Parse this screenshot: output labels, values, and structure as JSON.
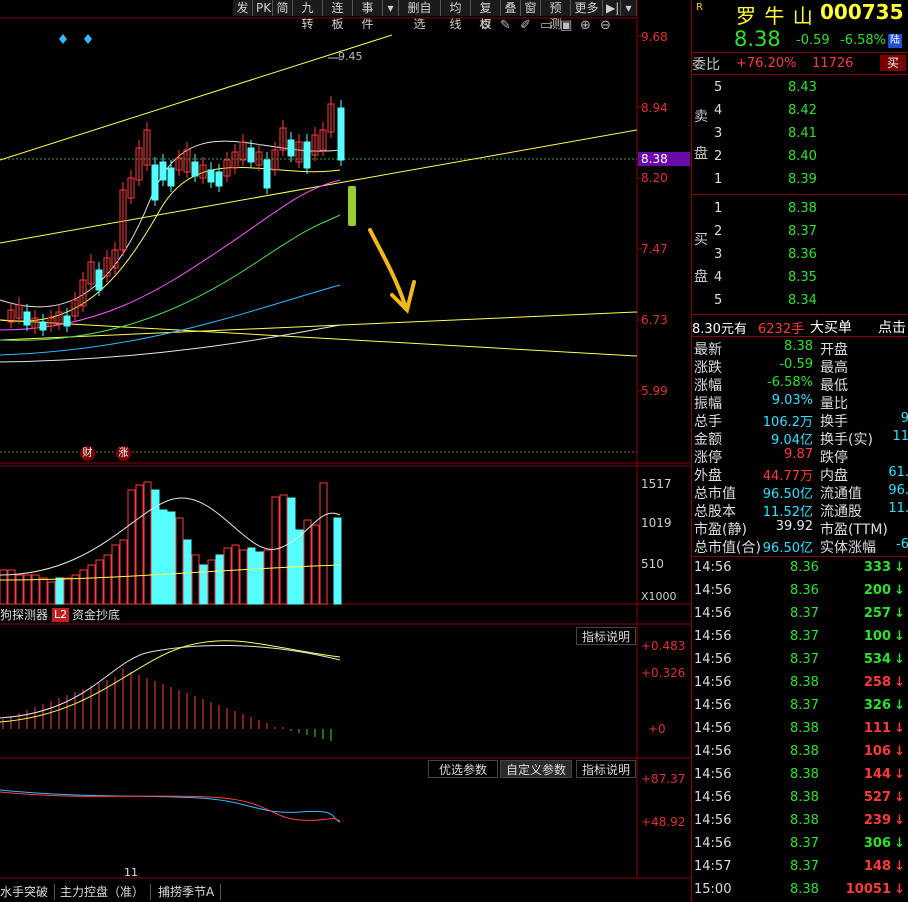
{
  "toolbar": {
    "buttons": [
      "发",
      "PK",
      "简",
      "九转",
      "连板",
      "事件",
      "▾",
      "删自选",
      "均线",
      "复权",
      "叠",
      "窗",
      "预测",
      "更多"
    ],
    "icons": [
      "settings-icon",
      "pen-icon",
      "pencil-icon",
      "doc-icon",
      "lock-icon",
      "zoom-in-icon",
      "zoom-out-icon"
    ]
  },
  "main_chart": {
    "price_labels": [
      "9.68",
      "8.94",
      "8.38",
      "8.20",
      "7.47",
      "6.73",
      "5.99"
    ],
    "current_price_tag": "8.38",
    "high_annotation": "9.45",
    "event_markers": [
      "财",
      "涨"
    ]
  },
  "volume_chart": {
    "labels": [
      "1517",
      "1019",
      "510",
      "X1000"
    ]
  },
  "indicator_tabs": {
    "left": [
      "狗探测器",
      "L2",
      "资金抄底"
    ],
    "explain_btn": "指标说明"
  },
  "macd_panel": {
    "labels": [
      "+0.483",
      "+0.326",
      "+0"
    ]
  },
  "kd_panel": {
    "buttons": [
      "优选参数",
      "自定义参数",
      "指标说明"
    ],
    "labels": [
      "+87.37",
      "+48.92"
    ]
  },
  "date_label": "11",
  "bottom_tabs": [
    "水手突破",
    "主力控盘（准）",
    "捕捞季节A"
  ],
  "stock": {
    "market": "R",
    "name": "罗 牛 山",
    "code": "000735",
    "price": "8.38",
    "change": "-0.59",
    "change_pct": "-6.58%",
    "tag": "陆"
  },
  "weibi": {
    "label": "委比",
    "ratio": "+76.20%",
    "diff": "11726",
    "buy_btn": "买"
  },
  "sell_side": {
    "label1": "卖",
    "label2": "盘",
    "rows": [
      {
        "lvl": "5",
        "price": "8.43"
      },
      {
        "lvl": "4",
        "price": "8.42"
      },
      {
        "lvl": "3",
        "price": "8.41"
      },
      {
        "lvl": "2",
        "price": "8.40"
      },
      {
        "lvl": "1",
        "price": "8.39"
      }
    ]
  },
  "buy_side": {
    "label1": "买",
    "label2": "盘",
    "rows": [
      {
        "lvl": "1",
        "price": "8.38"
      },
      {
        "lvl": "2",
        "price": "8.37"
      },
      {
        "lvl": "3",
        "price": "8.36"
      },
      {
        "lvl": "4",
        "price": "8.35"
      },
      {
        "lvl": "5",
        "price": "8.34"
      }
    ]
  },
  "big_order": {
    "price": "8.30元有",
    "vol": "6232手",
    "type": "大买单",
    "action": "点击"
  },
  "quote": [
    {
      "l": "最新",
      "v": "8.38",
      "vc": "grn",
      "r": "开盘",
      "rv": ""
    },
    {
      "l": "涨跌",
      "v": "-0.59",
      "vc": "grn",
      "r": "最高",
      "rv": ""
    },
    {
      "l": "涨幅",
      "v": "-6.58%",
      "vc": "grn",
      "r": "最低",
      "rv": ""
    },
    {
      "l": "振幅",
      "v": "9.03%",
      "vc": "cyan",
      "r": "量比",
      "rv": ""
    },
    {
      "l": "总手",
      "v": "106.2万",
      "vc": "cyan",
      "r": "换手",
      "rv": "9"
    },
    {
      "l": "金额",
      "v": "9.04亿",
      "vc": "cyan",
      "r": "换手(实)",
      "rv": "11"
    },
    {
      "l": "涨停",
      "v": "9.87",
      "vc": "red",
      "r": "跌停",
      "rv": ""
    },
    {
      "l": "外盘",
      "v": "44.77万",
      "vc": "red",
      "r": "内盘",
      "rv": "61."
    },
    {
      "l": "总市值",
      "v": "96.50亿",
      "vc": "cyan",
      "r": "流通值",
      "rv": "96."
    },
    {
      "l": "总股本",
      "v": "11.52亿",
      "vc": "cyan",
      "r": "流通股",
      "rv": "11."
    },
    {
      "l": "市盈(静)",
      "v": "39.92",
      "vc": "wht",
      "r": "市盈(TTM)",
      "rv": ""
    },
    {
      "l": "总市值(合)",
      "v": "96.50亿",
      "vc": "cyan",
      "r": "实体涨幅",
      "rv": "-6"
    }
  ],
  "ticks": [
    {
      "t": "14:56",
      "p": "8.36",
      "v": "333",
      "d": "down"
    },
    {
      "t": "14:56",
      "p": "8.36",
      "v": "200",
      "d": "down"
    },
    {
      "t": "14:56",
      "p": "8.37",
      "v": "257",
      "d": "down"
    },
    {
      "t": "14:56",
      "p": "8.37",
      "v": "100",
      "d": "down"
    },
    {
      "t": "14:56",
      "p": "8.37",
      "v": "534",
      "d": "down"
    },
    {
      "t": "14:56",
      "p": "8.38",
      "v": "258",
      "d": "up"
    },
    {
      "t": "14:56",
      "p": "8.37",
      "v": "326",
      "d": "down"
    },
    {
      "t": "14:56",
      "p": "8.38",
      "v": "111",
      "d": "up"
    },
    {
      "t": "14:56",
      "p": "8.38",
      "v": "106",
      "d": "up"
    },
    {
      "t": "14:56",
      "p": "8.38",
      "v": "144",
      "d": "up"
    },
    {
      "t": "14:56",
      "p": "8.38",
      "v": "527",
      "d": "up"
    },
    {
      "t": "14:56",
      "p": "8.38",
      "v": "239",
      "d": "up"
    },
    {
      "t": "14:56",
      "p": "8.37",
      "v": "306",
      "d": "down"
    },
    {
      "t": "14:57",
      "p": "8.37",
      "v": "148",
      "d": "up"
    },
    {
      "t": "15:00",
      "p": "8.38",
      "v": "10051",
      "d": "up"
    }
  ],
  "colors": {
    "up": "#ff3a3a",
    "down": "#2ee12e",
    "border": "#8a0000",
    "cyan": "#33e0ff"
  }
}
